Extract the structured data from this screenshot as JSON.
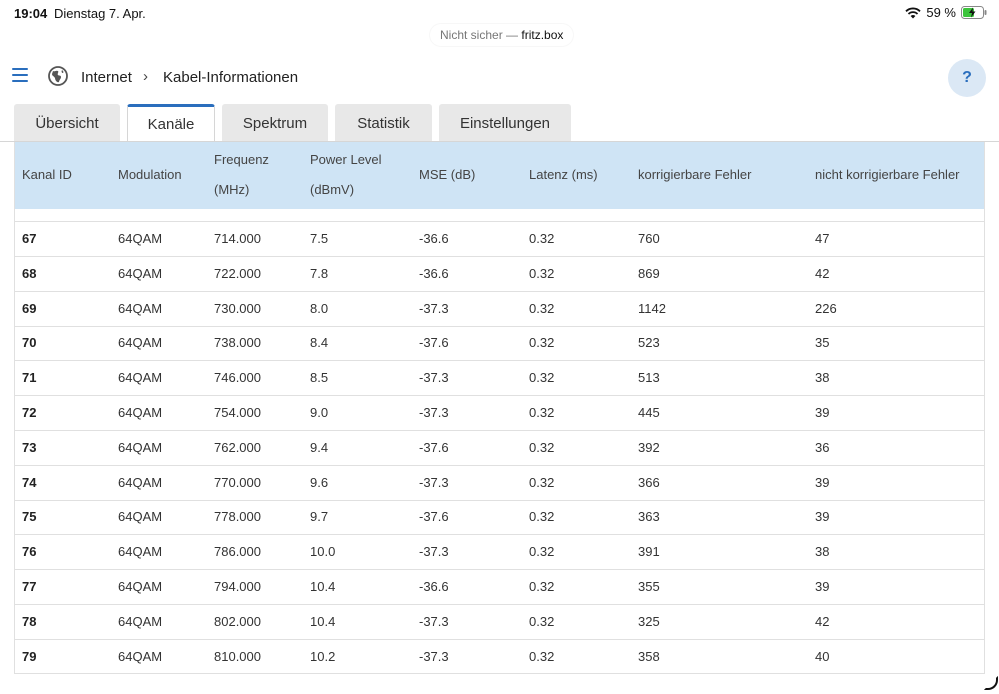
{
  "statusbar": {
    "time": "19:04",
    "date": "Dienstag 7. Apr.",
    "battery": "59 %"
  },
  "browser": {
    "insecure_label": "Nicht sicher —",
    "host": "fritz.box"
  },
  "breadcrumb": {
    "section": "Internet",
    "separator": "›",
    "page": "Kabel-Informationen"
  },
  "help": {
    "label": "?"
  },
  "tabs": [
    {
      "label": "Übersicht"
    },
    {
      "label": "Kanäle"
    },
    {
      "label": "Spektrum"
    },
    {
      "label": "Statistik"
    },
    {
      "label": "Einstellungen"
    }
  ],
  "table": {
    "headers": {
      "kanal_id": "Kanal ID",
      "modulation": "Modulation",
      "frequenz_1": "Frequenz",
      "frequenz_2": "(MHz)",
      "power_1": "Power Level",
      "power_2": "(dBmV)",
      "mse": "MSE (dB)",
      "latenz": "Latenz (ms)",
      "korr": "korrigierbare Fehler",
      "nicht_korr": "nicht korrigierbare Fehler"
    },
    "rows": [
      {
        "id": "67",
        "mod": "64QAM",
        "freq": "714.000",
        "power": "7.5",
        "mse": "-36.6",
        "lat": "0.32",
        "korr": "760",
        "nkorr": "47"
      },
      {
        "id": "68",
        "mod": "64QAM",
        "freq": "722.000",
        "power": "7.8",
        "mse": "-36.6",
        "lat": "0.32",
        "korr": "869",
        "nkorr": "42"
      },
      {
        "id": "69",
        "mod": "64QAM",
        "freq": "730.000",
        "power": "8.0",
        "mse": "-37.3",
        "lat": "0.32",
        "korr": "1142",
        "nkorr": "226"
      },
      {
        "id": "70",
        "mod": "64QAM",
        "freq": "738.000",
        "power": "8.4",
        "mse": "-37.6",
        "lat": "0.32",
        "korr": "523",
        "nkorr": "35"
      },
      {
        "id": "71",
        "mod": "64QAM",
        "freq": "746.000",
        "power": "8.5",
        "mse": "-37.3",
        "lat": "0.32",
        "korr": "513",
        "nkorr": "38"
      },
      {
        "id": "72",
        "mod": "64QAM",
        "freq": "754.000",
        "power": "9.0",
        "mse": "-37.3",
        "lat": "0.32",
        "korr": "445",
        "nkorr": "39"
      },
      {
        "id": "73",
        "mod": "64QAM",
        "freq": "762.000",
        "power": "9.4",
        "mse": "-37.6",
        "lat": "0.32",
        "korr": "392",
        "nkorr": "36"
      },
      {
        "id": "74",
        "mod": "64QAM",
        "freq": "770.000",
        "power": "9.6",
        "mse": "-37.3",
        "lat": "0.32",
        "korr": "366",
        "nkorr": "39"
      },
      {
        "id": "75",
        "mod": "64QAM",
        "freq": "778.000",
        "power": "9.7",
        "mse": "-37.6",
        "lat": "0.32",
        "korr": "363",
        "nkorr": "39"
      },
      {
        "id": "76",
        "mod": "64QAM",
        "freq": "786.000",
        "power": "10.0",
        "mse": "-37.3",
        "lat": "0.32",
        "korr": "391",
        "nkorr": "38"
      },
      {
        "id": "77",
        "mod": "64QAM",
        "freq": "794.000",
        "power": "10.4",
        "mse": "-36.6",
        "lat": "0.32",
        "korr": "355",
        "nkorr": "39"
      },
      {
        "id": "78",
        "mod": "64QAM",
        "freq": "802.000",
        "power": "10.4",
        "mse": "-37.3",
        "lat": "0.32",
        "korr": "325",
        "nkorr": "42"
      },
      {
        "id": "79",
        "mod": "64QAM",
        "freq": "810.000",
        "power": "10.2",
        "mse": "-37.3",
        "lat": "0.32",
        "korr": "358",
        "nkorr": "40"
      }
    ]
  },
  "colors": {
    "accent": "#2a6ebd",
    "header_bg": "#cfe4f5",
    "tab_bg": "#e8e8e8",
    "help_bg": "#dbe8f5"
  },
  "icons": {
    "menu": "menu-icon",
    "globe": "globe-icon",
    "wifi": "wifi-icon",
    "battery": "battery-charging-icon"
  }
}
